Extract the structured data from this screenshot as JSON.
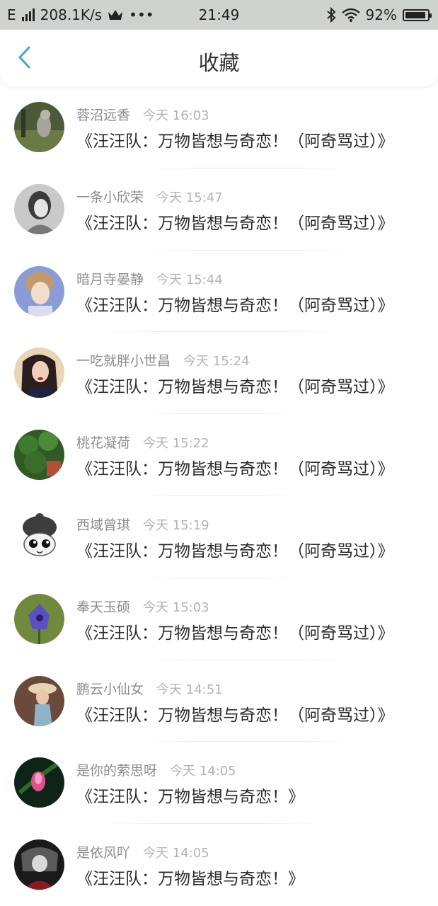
{
  "status_bar": {
    "network_type": "E",
    "speed": "208.1K/s",
    "dots": "•••",
    "time": "21:49",
    "battery_percent": "92%",
    "battery_level": 0.92,
    "icons": [
      "signal-icon",
      "crown-icon",
      "bluetooth-icon",
      "wifi-icon",
      "battery-icon"
    ]
  },
  "header": {
    "back_icon": "chevron-left-icon",
    "title": "收藏",
    "accent_color": "#3da7e8"
  },
  "items": [
    {
      "user": "蓉沼远香",
      "time": "今天 16:03",
      "message": "《汪汪队：万物皆想与奇恋！（阿奇骂过）》"
    },
    {
      "user": "一条小欣荣",
      "time": "今天 15:47",
      "message": "《汪汪队：万物皆想与奇恋！（阿奇骂过）》"
    },
    {
      "user": "暗月寺晏静",
      "time": "今天 15:44",
      "message": "《汪汪队：万物皆想与奇恋！（阿奇骂过）》"
    },
    {
      "user": "一吃就胖小世昌",
      "time": "今天 15:24",
      "message": "《汪汪队：万物皆想与奇恋！（阿奇骂过）》"
    },
    {
      "user": "桃花凝荷",
      "time": "今天 15:22",
      "message": "《汪汪队：万物皆想与奇恋！（阿奇骂过）》"
    },
    {
      "user": "西域曾琪",
      "time": "今天 15:19",
      "message": "《汪汪队：万物皆想与奇恋！（阿奇骂过）》"
    },
    {
      "user": "奉天玉硕",
      "time": "今天 15:03",
      "message": "《汪汪队：万物皆想与奇恋！（阿奇骂过）》"
    },
    {
      "user": "鹏云小仙女",
      "time": "今天 14:51",
      "message": "《汪汪队：万物皆想与奇恋！（阿奇骂过）》"
    },
    {
      "user": "是你的萦思呀",
      "time": "今天 14:05",
      "message": "《汪汪队：万物皆想与奇恋！》"
    },
    {
      "user": "是依风吖",
      "time": "今天 14:05",
      "message": "《汪汪队：万物皆想与奇恋！》"
    }
  ]
}
